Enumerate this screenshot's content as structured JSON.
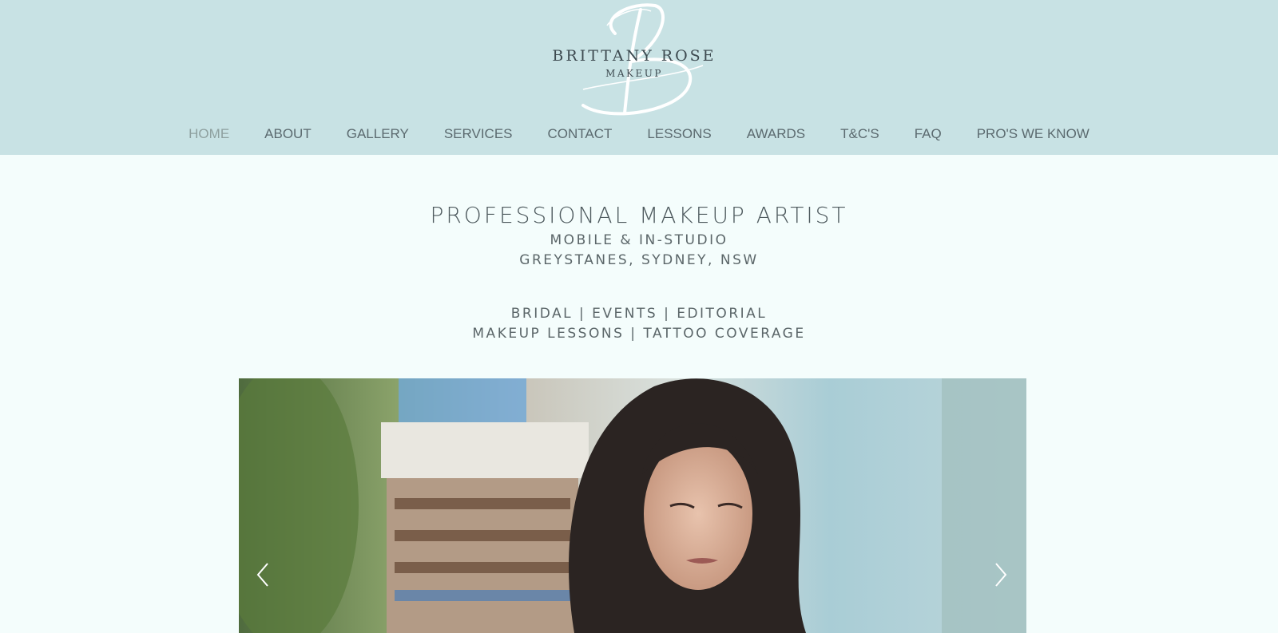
{
  "logo": {
    "line1": "BRITTANY ROSE",
    "line2": "MAKEUP"
  },
  "nav": {
    "items": [
      {
        "label": "HOME",
        "active": true
      },
      {
        "label": "ABOUT"
      },
      {
        "label": "GALLERY"
      },
      {
        "label": "SERVICES"
      },
      {
        "label": "CONTACT"
      },
      {
        "label": "LESSONS"
      },
      {
        "label": "AWARDS"
      },
      {
        "label": "T&C'S"
      },
      {
        "label": "FAQ"
      },
      {
        "label": "PRO'S WE KNOW"
      }
    ]
  },
  "intro": {
    "title": "PROFESSIONAL MAKEUP ARTIST",
    "line1": "MOBILE & IN-STUDIO",
    "line2": "GREYSTANES, SYDNEY, NSW",
    "services1": "BRIDAL | EVENTS | EDITORIAL",
    "services2": "MAKEUP LESSONS | TATTOO COVERAGE"
  },
  "colors": {
    "header_bg": "#c8e2e4",
    "page_bg": "#f4fdfc",
    "text": "#4e5a5e"
  }
}
